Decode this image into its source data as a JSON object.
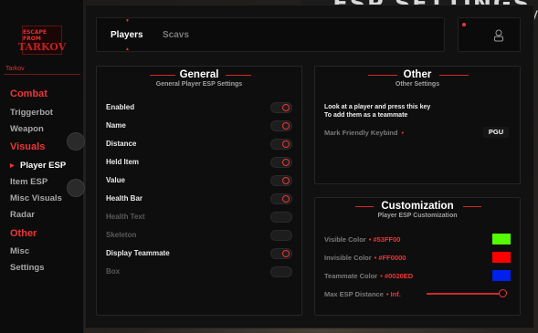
{
  "colors": {
    "accent": "#EF3535",
    "panel": "#0E0E0E"
  },
  "brand": {
    "logo_text_top": "ESCAPE FROM",
    "logo_text_big": "TARKOV",
    "name": "Tarkov"
  },
  "sidebar": {
    "sections": [
      {
        "label": "Combat",
        "items": [
          "Triggerbot",
          "Weapon"
        ]
      },
      {
        "label": "Visuals",
        "items": [
          "Player ESP",
          "Item ESP",
          "Misc Visuals",
          "Radar"
        ]
      },
      {
        "label": "Other",
        "items": [
          "Misc",
          "Settings"
        ]
      }
    ],
    "active_item": "Player ESP"
  },
  "tabs": [
    {
      "label": "Players",
      "active": true
    },
    {
      "label": "Scavs",
      "active": false
    }
  ],
  "general": {
    "title": "General",
    "subtitle": "General Player ESP Settings",
    "rows": [
      {
        "label": "Enabled",
        "on": true,
        "dim": false
      },
      {
        "label": "Name",
        "on": true,
        "dim": false
      },
      {
        "label": "Distance",
        "on": true,
        "dim": false
      },
      {
        "label": "Held Item",
        "on": true,
        "dim": false
      },
      {
        "label": "Value",
        "on": true,
        "dim": false
      },
      {
        "label": "Health Bar",
        "on": true,
        "dim": false
      },
      {
        "label": "Health Text",
        "on": false,
        "dim": true
      },
      {
        "label": "Skeleton",
        "on": false,
        "dim": true
      },
      {
        "label": "Display Teammate",
        "on": true,
        "dim": false
      },
      {
        "label": "Box",
        "on": false,
        "dim": true
      }
    ]
  },
  "other": {
    "title": "Other",
    "subtitle": "Other Settings",
    "info_line1": "Look at a player and press this key",
    "info_line2": "To add them as a teammate",
    "keybind_label": "Mark Friendly Keybind",
    "keybind_dot": "•",
    "keybind_value": "PGU"
  },
  "customization": {
    "title": "Customization",
    "subtitle": "Player ESP Customization",
    "colors": [
      {
        "label": "Visible Color",
        "hex": "#53FF00"
      },
      {
        "label": "Invisible Color",
        "hex": "#FF0000"
      },
      {
        "label": "Teammate Color",
        "hex": "#0020ED"
      }
    ],
    "distance_label": "Max ESP Distance",
    "distance_value": "Inf.",
    "distance_slider": 1.0
  },
  "background": {
    "title": "ESP SETTINGS",
    "side_letter": "V"
  }
}
